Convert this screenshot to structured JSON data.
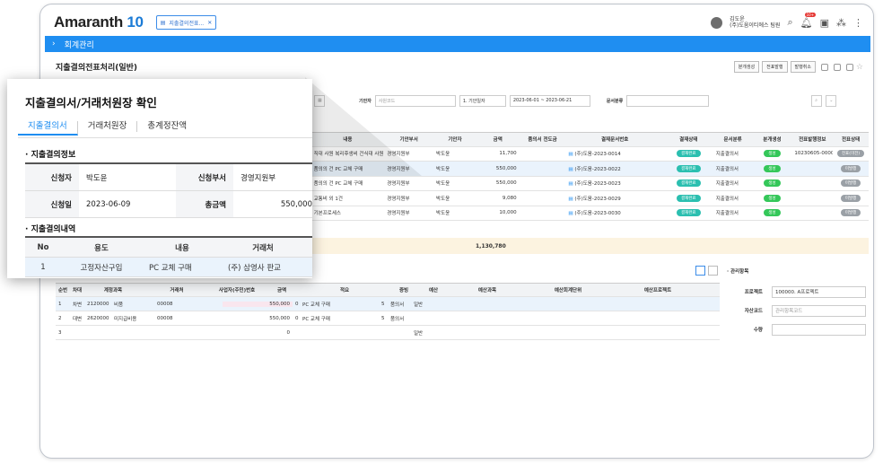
{
  "app": {
    "logo_main": "Amaranth",
    "logo_num": "10",
    "doc_tab": "지출결의전표..."
  },
  "user": {
    "name": "김도윤",
    "org": "(주)도움이티에스 팀원",
    "badge": "10+"
  },
  "menu": {
    "title": "회계관리"
  },
  "page": {
    "title": "지출결의전표처리(일반)"
  },
  "toolbar": {
    "btn1": "분개생성",
    "btn2": "전표발행",
    "btn3": "발행취소"
  },
  "search": {
    "drafter_label": "기안자",
    "drafter_placeholder": "사원코드",
    "date_type": "1. 기안일자",
    "date_range": "2023-06-01 ~ 2023-06-21",
    "doc_label": "문서분류"
  },
  "grid1": {
    "headers": [
      "내용",
      "기안부서",
      "기안자",
      "금액",
      "품의서 전도금",
      "결재문서번호",
      "결재상태",
      "문서분류",
      "분개생성",
      "전표발행정보",
      "전표상태"
    ],
    "rows": [
      [
        "직대 사원 복리후생비 건식대 사원",
        "경영지원부",
        "박도윤",
        "11,700",
        "",
        "(주)도움-2023-0014",
        "결재완료",
        "지출결의서",
        "생성",
        "10230605-00001",
        "전표(미전)"
      ],
      [
        "품의의 건 PC 교체 구매",
        "경영지원부",
        "박도윤",
        "550,000",
        "",
        "(주)도움-2023-0022",
        "결재완료",
        "지출결의서",
        "생성",
        "",
        "미발행"
      ],
      [
        "품의의 건 PC 교체 구매",
        "경영지원부",
        "박도윤",
        "550,000",
        "",
        "(주)도움-2023-0023",
        "결재완료",
        "지출결의서",
        "생성",
        "",
        "미발행"
      ],
      [
        "교통비 외 1건",
        "경영지원부",
        "박도윤",
        "9,080",
        "",
        "(주)도움-2023-0029",
        "결재완료",
        "지출결의서",
        "생성",
        "",
        "미발행"
      ],
      [
        "기본프로세스",
        "경영지원부",
        "박도윤",
        "10,000",
        "",
        "(주)도움-2023-0030",
        "결재완료",
        "지출결의서",
        "생성",
        "",
        "미발행"
      ]
    ],
    "total": "1,130,780"
  },
  "grid2": {
    "headers": [
      "순번",
      "차대",
      "계정과목",
      "거래처",
      "사업자(주민)번호",
      "금액",
      "적요",
      "증빙",
      "예산",
      "예산과목",
      "예산회계단위",
      "예산프로젝트"
    ],
    "rows": [
      [
        "1",
        "차변",
        "2120000",
        "비품",
        "00008",
        "550,000",
        "0",
        "PC 교체 구매",
        "5",
        "품의서",
        "일반"
      ],
      [
        "2",
        "대변",
        "2620000",
        "미지급비용",
        "00008",
        "550,000",
        "0",
        "PC 교체 구매",
        "5",
        "품의서",
        ""
      ],
      [
        "3",
        "",
        "",
        "",
        "",
        "0",
        "",
        "",
        "",
        "",
        "일반"
      ]
    ]
  },
  "mgmt": {
    "title": "관리항목",
    "project_label": "프로젝트",
    "project_value": "100000. A프로젝트",
    "asset_label": "자산코드",
    "asset_placeholder": "관리항목코드",
    "qty_label": "수량"
  },
  "popup": {
    "title": "지출결의서/거래처원장 확인",
    "tabs": [
      "지출결의서",
      "거래처원장",
      "총계정잔액"
    ],
    "sec1": "지출결의정보",
    "applicant_label": "신청자",
    "applicant": "박도윤",
    "dept_label": "신청부서",
    "dept": "경영지원부",
    "date_label": "신청일",
    "date": "2023-06-09",
    "total_label": "총금액",
    "total": "550,000",
    "sec2": "지출결의내역",
    "detail_headers": [
      "No",
      "용도",
      "내용",
      "거래처"
    ],
    "detail_row": [
      "1",
      "고정자산구입",
      "PC 교체 구매",
      "(주) 삼영사 판교"
    ]
  },
  "colors": {
    "accent": "#1f8ef1",
    "status_done": "#2bbfb0",
    "status_green": "#34c759",
    "status_gray": "#9aa0a6"
  }
}
